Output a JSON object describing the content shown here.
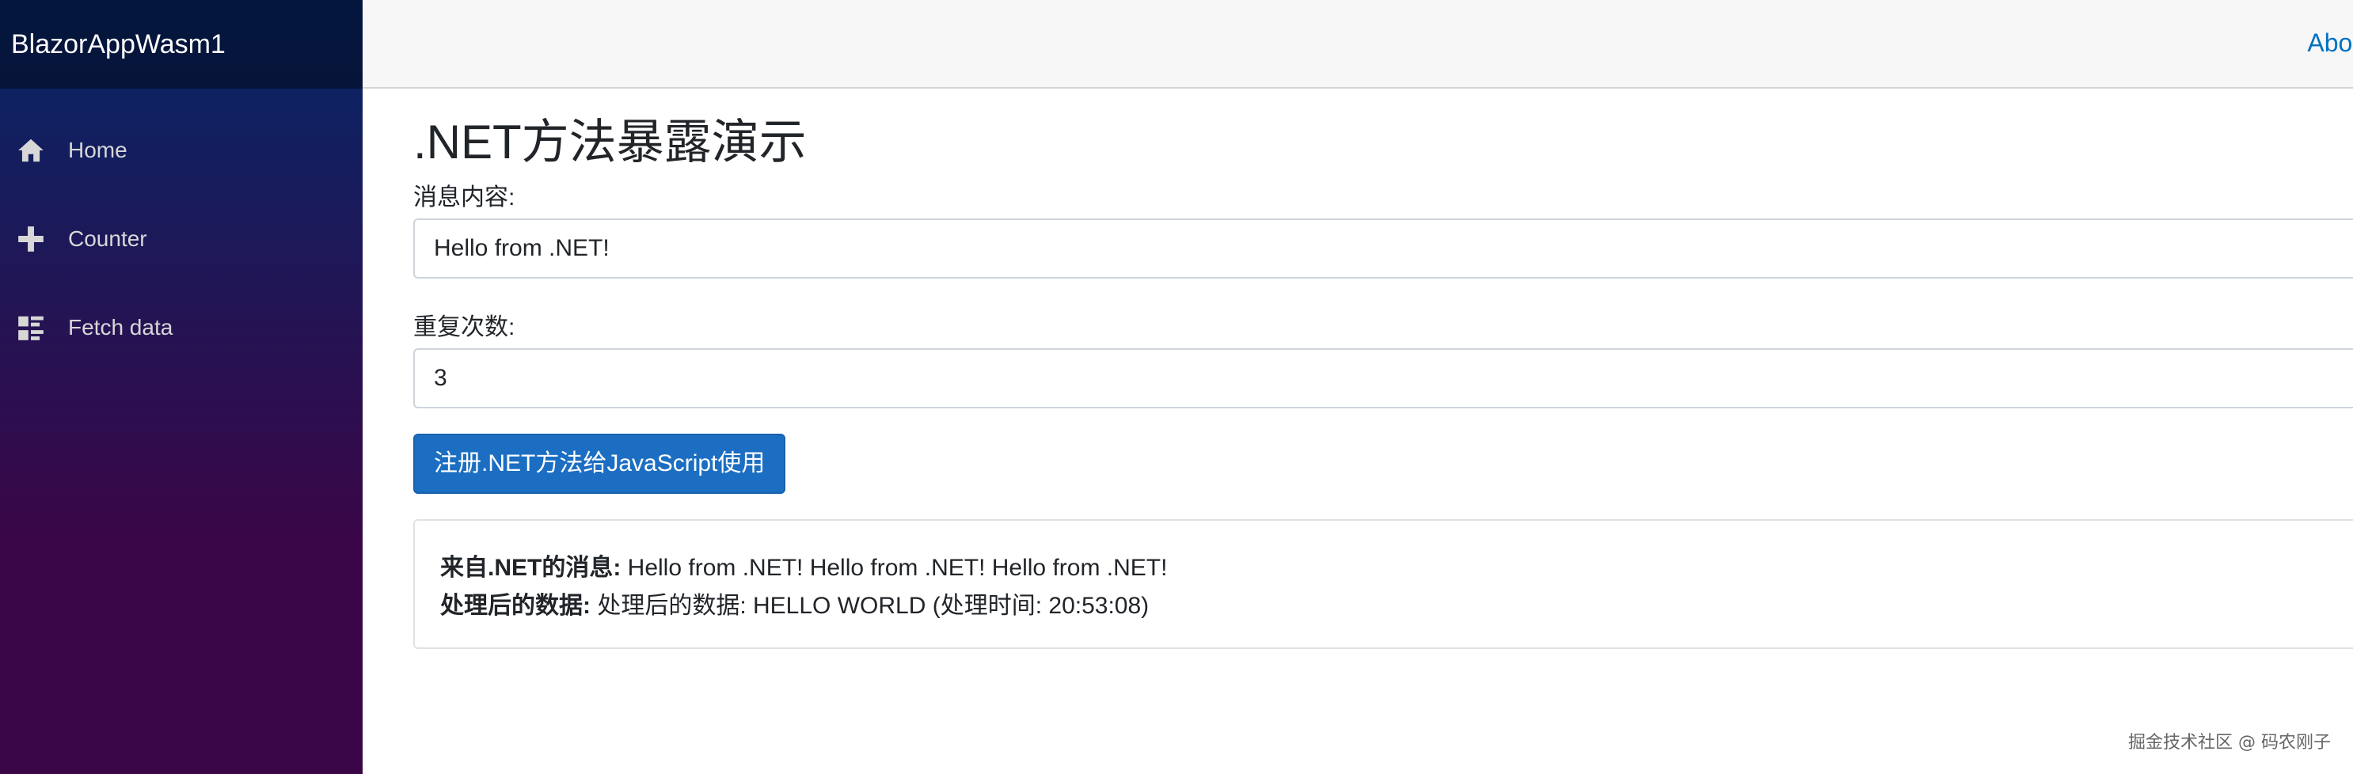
{
  "app": {
    "brand": "BlazorAppWasm1",
    "about_link": "About"
  },
  "sidebar": {
    "items": [
      {
        "label": "Home",
        "icon": "home-icon"
      },
      {
        "label": "Counter",
        "icon": "plus-icon"
      },
      {
        "label": "Fetch data",
        "icon": "list-rich-icon"
      }
    ]
  },
  "main": {
    "title": ".NET方法暴露演示",
    "message_label": "消息内容:",
    "message_value": "Hello from .NET!",
    "repeat_label": "重复次数:",
    "repeat_value": "3",
    "register_button": "注册.NET方法给JavaScript使用",
    "result": {
      "message_label": "来自.NET的消息:",
      "message_value": " Hello from .NET! Hello from .NET! Hello from .NET!",
      "processed_label": "处理后的数据:",
      "processed_value": " 处理后的数据: HELLO WORLD (处理时间: 20:53:08)"
    }
  },
  "watermark": "掘金技术社区 @ 码农刚子",
  "colors": {
    "accent": "#1b6ec2",
    "link": "#0071c1",
    "sidebar_top": "#052767",
    "sidebar_bottom": "#3a0647"
  }
}
